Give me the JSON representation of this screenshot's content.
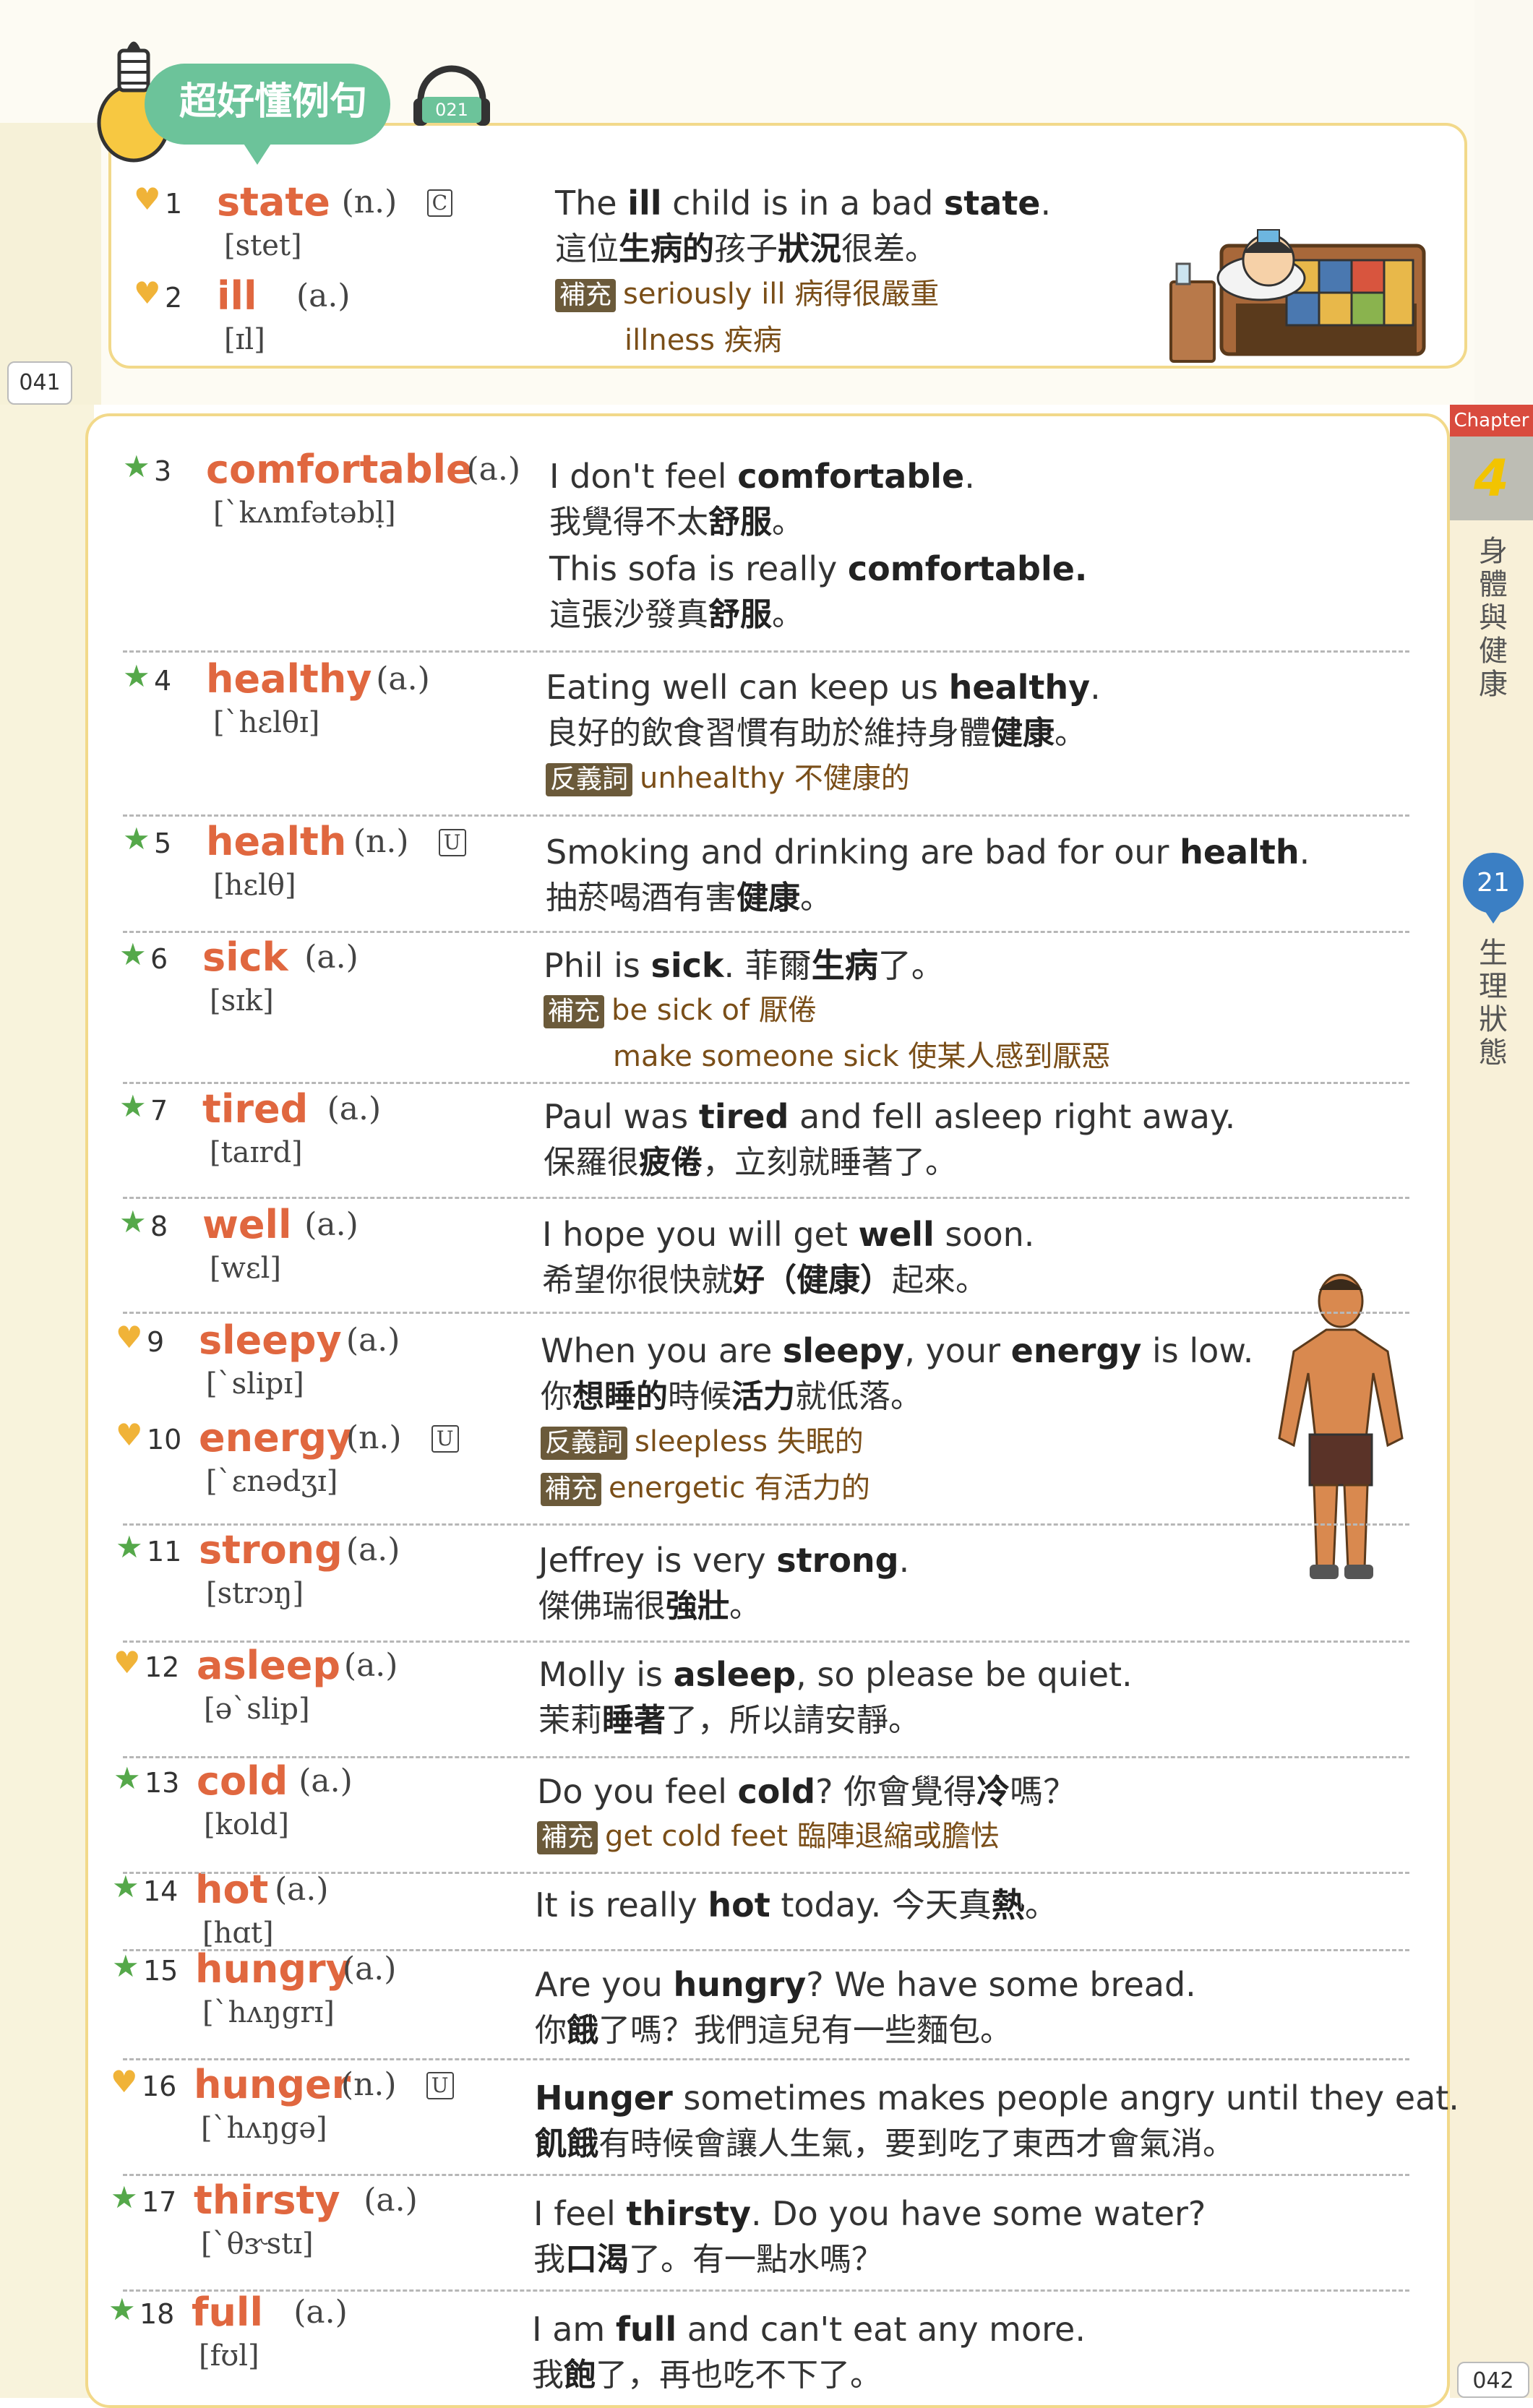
{
  "header": {
    "banner_label": "超好懂例句",
    "audio_track": "021",
    "page_left": "041",
    "page_right": "042"
  },
  "rail": {
    "chapter_label": "Chapter",
    "chapter_number": "4",
    "chapter_title": "身體與健康",
    "unit_number": "21",
    "unit_title": "生理狀態"
  },
  "entries": [
    {
      "n": "1",
      "icon": "heart",
      "word": "state",
      "pos": "(n.)",
      "count": "C",
      "ipa": "[stet]",
      "lines": [
        {
          "type": "en",
          "html": "The <b>ill</b> child is in a bad <b>state</b>."
        },
        {
          "type": "zh",
          "html": "這位<b>生病的</b>孩子<b>狀況</b>很差。"
        },
        {
          "type": "note",
          "tag": "補充",
          "html": "seriously ill 病得很嚴重"
        },
        {
          "type": "note2",
          "html": "illness 疾病"
        }
      ]
    },
    {
      "n": "2",
      "icon": "heart",
      "word": "ill",
      "pos": "(a.)",
      "count": "",
      "ipa": "[ɪl]",
      "lines": []
    },
    {
      "n": "3",
      "icon": "star",
      "word": "comfortable",
      "pos": "(a.)",
      "count": "",
      "ipa": "[ˋkʌmfətəbḷ]",
      "lines": [
        {
          "type": "en",
          "html": "I don't feel <b>comfortable</b>."
        },
        {
          "type": "zh",
          "html": "我覺得不太<b>舒服</b>。"
        },
        {
          "type": "en",
          "html": "This sofa is really <b>comfortable.</b>"
        },
        {
          "type": "zh",
          "html": "這張沙發真<b>舒服</b>。"
        }
      ]
    },
    {
      "n": "4",
      "icon": "star",
      "word": "healthy",
      "pos": "(a.)",
      "count": "",
      "ipa": "[ˋhɛlθɪ]",
      "lines": [
        {
          "type": "en",
          "html": "Eating well can keep us <b>healthy</b>."
        },
        {
          "type": "zh",
          "html": "良好的飲食習慣有助於維持身體<b>健康</b>。"
        },
        {
          "type": "note",
          "tag": "反義詞",
          "html": "unhealthy 不健康的"
        }
      ]
    },
    {
      "n": "5",
      "icon": "star",
      "word": "health",
      "pos": "(n.)",
      "count": "U",
      "ipa": "[hɛlθ]",
      "lines": [
        {
          "type": "en",
          "html": "Smoking and drinking are bad for our <b>health</b>."
        },
        {
          "type": "zh",
          "html": "抽菸喝酒有害<b>健康</b>。"
        }
      ]
    },
    {
      "n": "6",
      "icon": "star",
      "word": "sick",
      "pos": "(a.)",
      "count": "",
      "ipa": "[sɪk]",
      "lines": [
        {
          "type": "en",
          "html": "Phil is <b>sick</b>. 菲爾<b>生病</b>了。"
        },
        {
          "type": "note",
          "tag": "補充",
          "html": "be sick of 厭倦"
        },
        {
          "type": "note2",
          "html": "make someone sick 使某人感到厭惡"
        }
      ]
    },
    {
      "n": "7",
      "icon": "star",
      "word": "tired",
      "pos": "(a.)",
      "count": "",
      "ipa": "[taɪrd]",
      "lines": [
        {
          "type": "en",
          "html": "Paul was <b>tired</b> and fell asleep right away."
        },
        {
          "type": "zh",
          "html": "保羅很<b>疲倦</b>，立刻就睡著了。"
        }
      ]
    },
    {
      "n": "8",
      "icon": "star",
      "word": "well",
      "pos": "(a.)",
      "count": "",
      "ipa": "[wɛl]",
      "lines": [
        {
          "type": "en",
          "html": "I hope you will get <b>well</b> soon."
        },
        {
          "type": "zh",
          "html": "希望你很快就<b>好（健康）</b>起來。"
        }
      ]
    },
    {
      "n": "9",
      "icon": "heart",
      "word": "sleepy",
      "pos": "(a.)",
      "count": "",
      "ipa": "[ˋslipɪ]",
      "lines": [
        {
          "type": "en",
          "html": "When you are <b>sleepy</b>, your <b>energy</b> is low."
        },
        {
          "type": "zh",
          "html": "你<b>想睡的</b>時候<b>活力</b>就低落。"
        },
        {
          "type": "note",
          "tag": "反義詞",
          "html": "sleepless 失眠的"
        },
        {
          "type": "note",
          "tag": "補充",
          "html": "energetic 有活力的"
        }
      ]
    },
    {
      "n": "10",
      "icon": "heart",
      "word": "energy",
      "pos": "(n.)",
      "count": "U",
      "ipa": "[ˋɛnədʒɪ]",
      "lines": []
    },
    {
      "n": "11",
      "icon": "star",
      "word": "strong",
      "pos": "(a.)",
      "count": "",
      "ipa": "[strɔŋ]",
      "lines": [
        {
          "type": "en",
          "html": "Jeffrey is very <b>strong</b>."
        },
        {
          "type": "zh",
          "html": "傑佛瑞很<b>強壯</b>。"
        }
      ]
    },
    {
      "n": "12",
      "icon": "heart",
      "word": "asleep",
      "pos": "(a.)",
      "count": "",
      "ipa": "[əˋslip]",
      "lines": [
        {
          "type": "en",
          "html": "Molly is <b>asleep</b>, so please be quiet."
        },
        {
          "type": "zh",
          "html": "茉莉<b>睡著</b>了，所以請安靜。"
        }
      ]
    },
    {
      "n": "13",
      "icon": "star",
      "word": "cold",
      "pos": "(a.)",
      "count": "",
      "ipa": "[kold]",
      "lines": [
        {
          "type": "en",
          "html": "Do you feel <b>cold</b>? 你會覺得<b>冷</b>嗎？"
        },
        {
          "type": "note",
          "tag": "補充",
          "html": "get cold feet 臨陣退縮或膽怯"
        }
      ]
    },
    {
      "n": "14",
      "icon": "star",
      "word": "hot",
      "pos": "(a.)",
      "count": "",
      "ipa": "[hɑt]",
      "lines": [
        {
          "type": "en",
          "html": "It is really <b>hot</b> today. 今天真<b>熱</b>。"
        }
      ]
    },
    {
      "n": "15",
      "icon": "star",
      "word": "hungry",
      "pos": "(a.)",
      "count": "",
      "ipa": "[ˋhʌŋgrɪ]",
      "lines": [
        {
          "type": "en",
          "html": "Are you <b>hungry</b>? We have some bread."
        },
        {
          "type": "zh",
          "html": "你<b>餓</b>了嗎？我們這兒有一些麵包。"
        }
      ]
    },
    {
      "n": "16",
      "icon": "heart",
      "word": "hunger",
      "pos": "(n.)",
      "count": "U",
      "ipa": "[ˋhʌŋgə]",
      "lines": [
        {
          "type": "en",
          "html": "<b>Hunger</b> sometimes makes people angry until they eat."
        },
        {
          "type": "zh",
          "html": "<b>飢餓</b>有時候會讓人生氣，要到吃了東西才會氣消。"
        }
      ]
    },
    {
      "n": "17",
      "icon": "star",
      "word": "thirsty",
      "pos": "(a.)",
      "count": "",
      "ipa": "[ˋθɝstɪ]",
      "lines": [
        {
          "type": "en",
          "html": "I feel <b>thirsty</b>. Do you have some water?"
        },
        {
          "type": "zh",
          "html": "我<b>口渴</b>了。有一點水嗎？"
        }
      ]
    },
    {
      "n": "18",
      "icon": "star",
      "word": "full",
      "pos": "(a.)",
      "count": "",
      "ipa": "[fʊl]",
      "lines": [
        {
          "type": "en",
          "html": "I am <b>full</b> and can't eat any more."
        },
        {
          "type": "zh",
          "html": "我<b>飽</b>了，再也吃不下了。"
        }
      ]
    }
  ]
}
